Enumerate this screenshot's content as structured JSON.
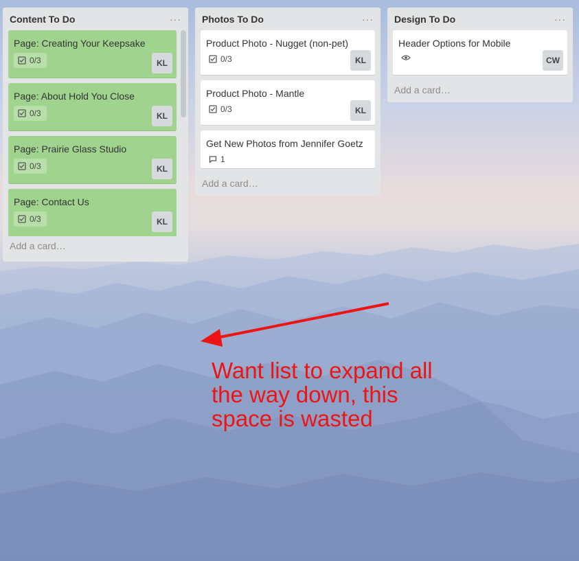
{
  "lists": [
    {
      "title": "Content To Do",
      "menu": "···",
      "add_card": "Add a card…",
      "cards": [
        {
          "title": "Page: Creating Your Keepsake",
          "checklist": "0/3",
          "member": "KL"
        },
        {
          "title": "Page: About Hold You Close",
          "checklist": "0/3",
          "member": "KL"
        },
        {
          "title": "Page: Prairie Glass Studio",
          "checklist": "0/3",
          "member": "KL"
        },
        {
          "title": "Page: Contact Us",
          "checklist": "0/3",
          "member": "KL"
        }
      ],
      "card_color": "#9fd38e"
    },
    {
      "title": "Photos To Do",
      "menu": "···",
      "add_card": "Add a card…",
      "cards": [
        {
          "title": "Product Photo - Nugget (non-pet)",
          "checklist": "0/3",
          "member": "KL"
        },
        {
          "title": "Product Photo - Mantle",
          "checklist": "0/3",
          "member": "KL"
        },
        {
          "title": "Get New Photos from Jennifer Goetz",
          "comments": "1"
        }
      ]
    },
    {
      "title": "Design To Do",
      "menu": "···",
      "add_card": "Add a card…",
      "cards": [
        {
          "title": "Header Options for Mobile",
          "watching_icon": "eye-icon",
          "member": "CW"
        }
      ]
    }
  ],
  "annotation": {
    "text": "Want list to expand all the way down, this space is wasted",
    "color": "#ee1414"
  }
}
